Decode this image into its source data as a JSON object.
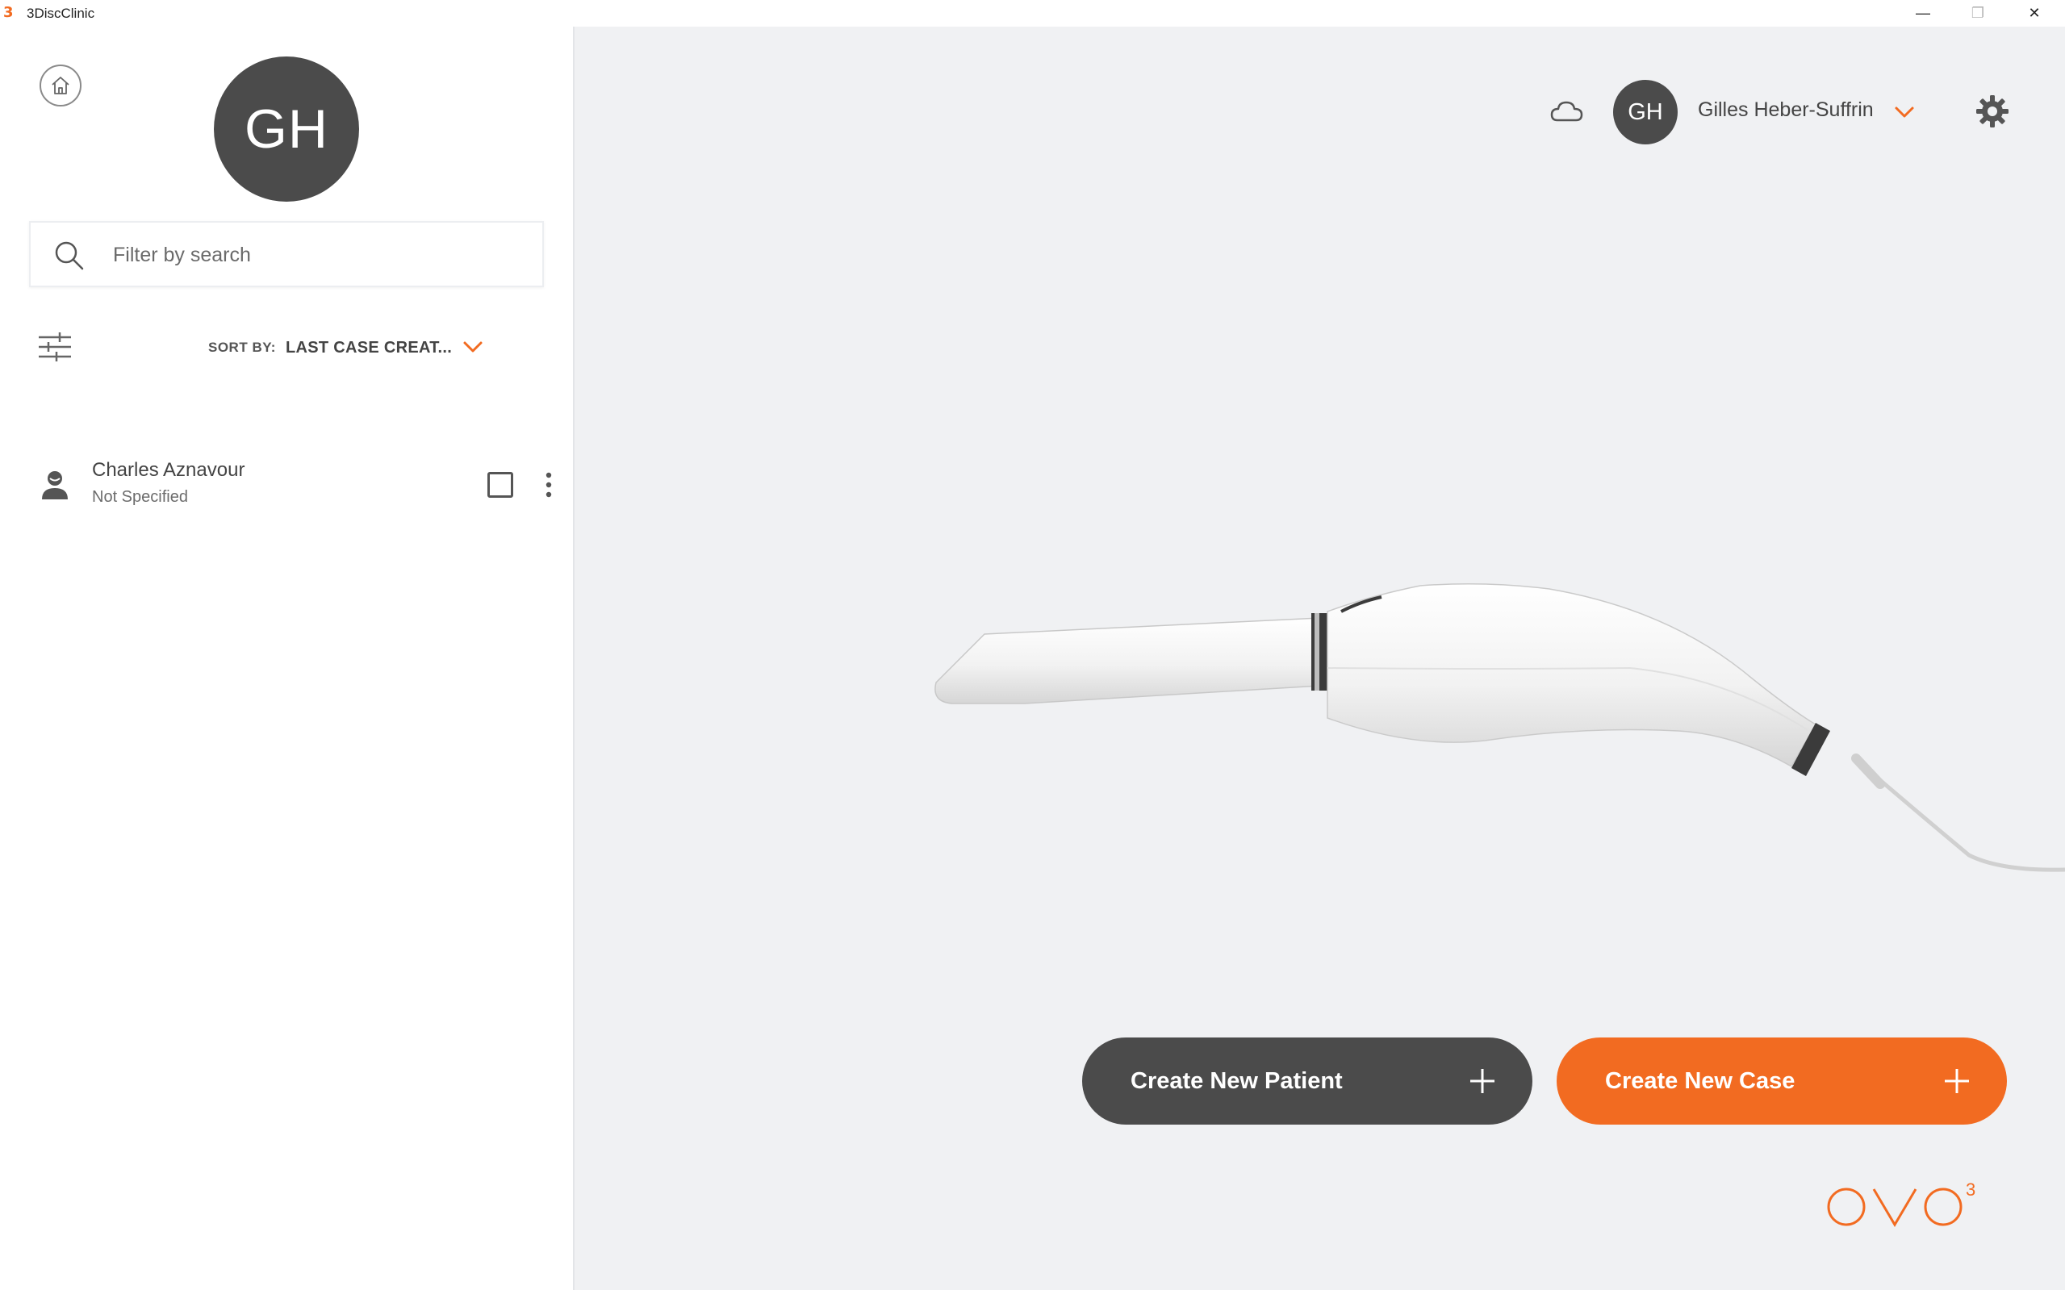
{
  "window": {
    "title": "3DiscClinic",
    "logo_glyph": "3",
    "minimize_glyph": "—",
    "maximize_glyph": "❐",
    "close_glyph": "✕"
  },
  "sidebar": {
    "avatar_initials": "GH",
    "search": {
      "placeholder": "Filter by search",
      "value": ""
    },
    "sort": {
      "label": "SORT BY:",
      "value": "LAST CASE CREAT..."
    },
    "patients": [
      {
        "name": "Charles Aznavour",
        "subtitle": "Not Specified",
        "checked": false
      }
    ]
  },
  "header": {
    "avatar_initials": "GH",
    "user_name": "Gilles Heber-Suffrin",
    "icons": [
      "cloud-icon",
      "chevron-down-icon",
      "gear-icon"
    ]
  },
  "actions": {
    "create_patient_label": "Create New Patient",
    "create_case_label": "Create New Case"
  },
  "brand": {
    "text": "OVO",
    "superscript": "3"
  },
  "colors": {
    "accent": "#f26b21",
    "dark": "#4b4b4b",
    "background": "#f0f1f3",
    "sidebar": "#ffffff"
  }
}
